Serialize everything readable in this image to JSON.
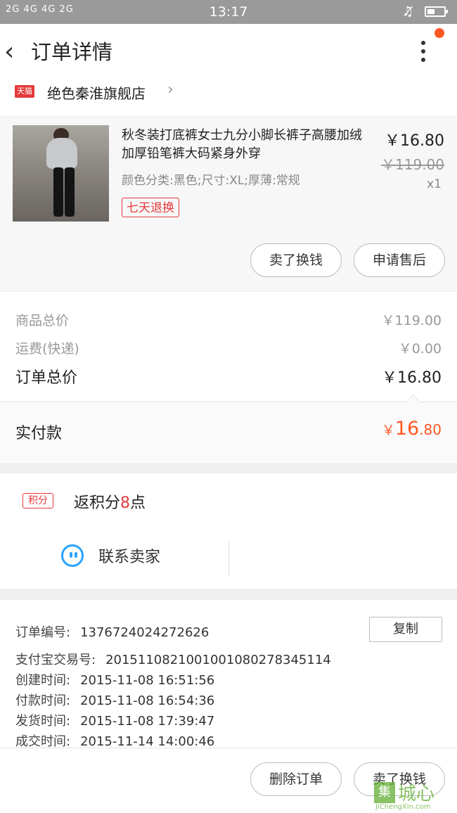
{
  "status_bar": {
    "signal": "2G  4G 4G  2G",
    "time": "13:17",
    "icons": [
      "signal-icon",
      "silent-bell-icon",
      "battery-icon"
    ]
  },
  "header": {
    "title": "订单详情",
    "back_icon": "chevron-left-icon",
    "more_icon": "more-vertical-icon"
  },
  "store": {
    "badge": "天猫",
    "name": "绝色秦淮旗舰店"
  },
  "product": {
    "title": "秋冬装打底裤女士九分小脚长裤子高腰加绒加厚铅笔裤大码紧身外穿",
    "spec": "颜色分类:黑色;尺寸:XL;厚薄:常规",
    "badge": "七天退换",
    "price": "￥16.80",
    "original_price": "￥119.00",
    "quantity": "x1",
    "btn_sell": "卖了换钱",
    "btn_service": "申请售后"
  },
  "prices": {
    "goods_label": "商品总价",
    "goods_value": "￥119.00",
    "shipping_label": "运费(快递)",
    "shipping_value": "￥0.00",
    "order_label": "订单总价",
    "order_value": "￥16.80",
    "paid_label": "实付款",
    "paid_currency": "￥",
    "paid_int": "16",
    "paid_dec": ".80"
  },
  "points": {
    "tag": "积分",
    "text_prefix": "返积分",
    "count": "8",
    "text_suffix": "点"
  },
  "contact": {
    "label": "联系卖家",
    "icon": "chat-smile-icon"
  },
  "order_info": {
    "copy_button": "复制",
    "rows": [
      {
        "key": "订单编号:",
        "value": "1376724024272626"
      },
      {
        "key": "支付宝交易号:",
        "value": "2015110821001001080278345114"
      },
      {
        "key": "创建时间:",
        "value": "2015-11-08 16:51:56"
      },
      {
        "key": "付款时间:",
        "value": "2015-11-08 16:54:36"
      },
      {
        "key": "发货时间:",
        "value": "2015-11-08 17:39:47"
      },
      {
        "key": "成交时间:",
        "value": "2015-11-14 14:00:46"
      }
    ]
  },
  "bottom": {
    "delete": "删除订单",
    "sell": "卖了换钱"
  },
  "watermark": {
    "char": "集",
    "name": "城心",
    "url": "JiChengXin.com"
  }
}
